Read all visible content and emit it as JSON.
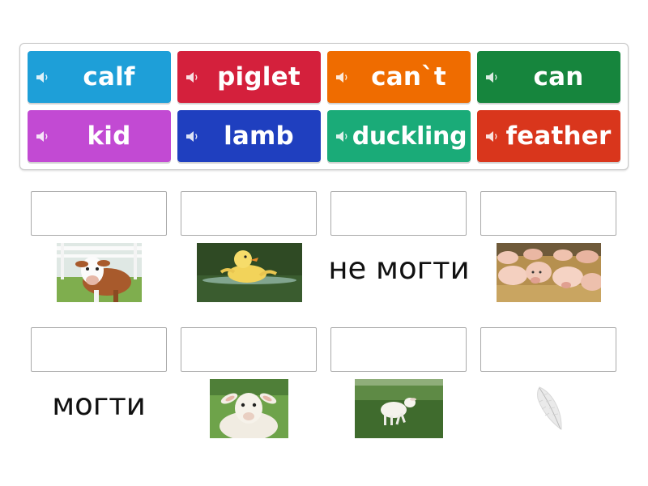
{
  "word_bank": {
    "tiles": [
      {
        "label": "calf",
        "color": "#1e9fd8"
      },
      {
        "label": "piglet",
        "color": "#d4203c"
      },
      {
        "label": "can`t",
        "color": "#ef6c00"
      },
      {
        "label": "can",
        "color": "#16853d"
      },
      {
        "label": "kid",
        "color": "#c24ad3"
      },
      {
        "label": "lamb",
        "color": "#1f3fbf"
      },
      {
        "label": "duckling",
        "color": "#1aab78"
      },
      {
        "label": "feather",
        "color": "#d9361c"
      }
    ],
    "speaker_icon": "speaker-icon"
  },
  "targets": {
    "row1": [
      {
        "clue_type": "image",
        "image": "calf-photo"
      },
      {
        "clue_type": "image",
        "image": "duckling-photo"
      },
      {
        "clue_type": "text",
        "text": "не могти"
      },
      {
        "clue_type": "image",
        "image": "piglets-photo"
      }
    ],
    "row2": [
      {
        "clue_type": "text",
        "text": "могти"
      },
      {
        "clue_type": "image",
        "image": "goat-kid-photo"
      },
      {
        "clue_type": "image",
        "image": "lamb-photo"
      },
      {
        "clue_type": "image",
        "image": "feather-photo"
      }
    ]
  }
}
